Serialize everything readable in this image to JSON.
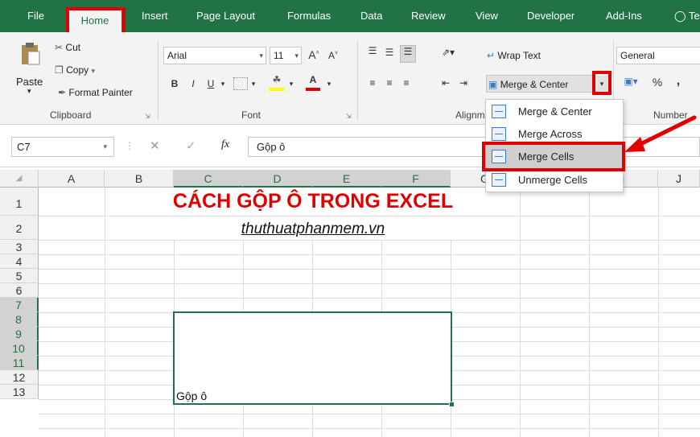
{
  "tabs": [
    "File",
    "Home",
    "Insert",
    "Page Layout",
    "Formulas",
    "Data",
    "Review",
    "View",
    "Developer",
    "Add-Ins",
    "Te"
  ],
  "clipboard": {
    "paste": "Paste",
    "cut": "Cut",
    "copy": "Copy",
    "format_painter": "Format Painter",
    "label": "Clipboard"
  },
  "font": {
    "name": "Arial",
    "size": "11",
    "label": "Font",
    "bold": "B",
    "italic": "I",
    "underline": "U"
  },
  "alignment": {
    "wrap_text": "Wrap Text",
    "merge_center": "Merge & Center",
    "label": "Alignm"
  },
  "number": {
    "format": "General",
    "percent": "%",
    "comma": ",",
    "label": "Number"
  },
  "formula_bar": {
    "name_box": "C7",
    "fx": "fx",
    "value": "Gộp ô"
  },
  "columns": [
    "A",
    "B",
    "C",
    "D",
    "E",
    "F",
    "G",
    "H",
    "I",
    "J"
  ],
  "rows": [
    "1",
    "2",
    "3",
    "4",
    "5",
    "6",
    "7",
    "8",
    "9",
    "10",
    "11",
    "12",
    "13"
  ],
  "sheet": {
    "title": "CÁCH GỘP Ô TRONG EXCEL",
    "subtitle": "thuthuatphanmem.vn",
    "merged_value": "Gộp ô"
  },
  "merge_menu": [
    "Merge & Center",
    "Merge Across",
    "Merge Cells",
    "Unmerge Cells"
  ],
  "colors": {
    "excel_green": "#217346",
    "highlight_red": "#e00000"
  }
}
